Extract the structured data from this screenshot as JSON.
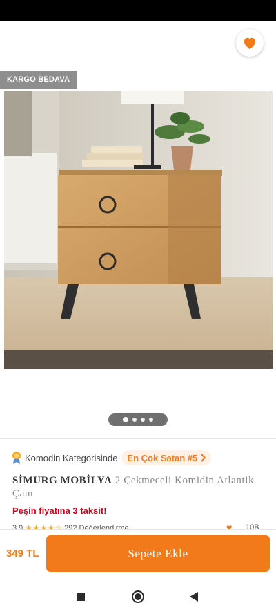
{
  "header": {
    "back_icon": "arrow-left-icon",
    "share_icon": "share-icon",
    "favorite_icon": "heart-icon"
  },
  "badge": {
    "label": "KARGO BEDAVA"
  },
  "gallery": {
    "pages": 4,
    "current": 1
  },
  "category": {
    "text": "Komodin Kategorisinde",
    "bestseller": "En Çok Satan #5"
  },
  "product": {
    "brand": "SİMURG MOBİLYA",
    "name": "2 Çekmeceli Komidin Atlantik Çam",
    "installment": "Peşin fiyatına 3 taksit!"
  },
  "rating": {
    "score": "3.9",
    "reviews": "292 Değerlendirme",
    "favorites": "10B"
  },
  "bottom": {
    "price": "349 TL",
    "add_to_cart": "Sepete Ekle"
  },
  "colors": {
    "accent": "#f27a1a",
    "installment": "#d0021b",
    "badge_bg": "#8e8e8e"
  }
}
